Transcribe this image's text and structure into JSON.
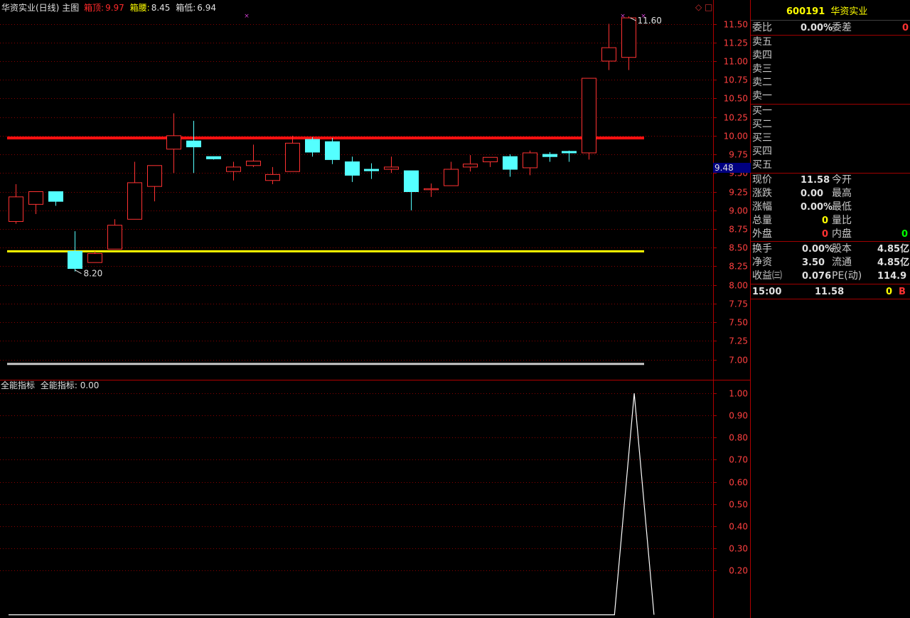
{
  "header": {
    "stock_title": "华资实业(日线)",
    "main_chart_label": "主图",
    "box_top_label": "箱顶:",
    "box_top_value": "9.97",
    "box_waist_label": "箱腰:",
    "box_waist_value": "8.45",
    "box_low_label": "箱低:",
    "box_low_value": "6.94"
  },
  "indicator": {
    "title": "全能指标",
    "name": "全能指标:",
    "value": "0.00"
  },
  "price_axis": {
    "ticks": [
      "11.50",
      "11.25",
      "11.00",
      "10.75",
      "10.50",
      "10.25",
      "10.00",
      "9.75",
      "9.50",
      "9.25",
      "9.00",
      "8.75",
      "8.50",
      "8.25",
      "8.00",
      "7.75",
      "7.50",
      "7.25",
      "7.00"
    ],
    "current_marker": "9.48"
  },
  "indicator_axis": {
    "ticks": [
      "1.00",
      "0.90",
      "0.80",
      "0.70",
      "0.60",
      "0.50",
      "0.40",
      "0.30",
      "0.20"
    ]
  },
  "annotations": {
    "high_label": "11.60",
    "low_label": "8.20"
  },
  "colors": {
    "up": "#ff3232",
    "down": "#54ffff",
    "box_top_line": "#ff1010",
    "box_waist_line": "#ffff00",
    "box_low_line": "#c8c8c8",
    "grid": "#8b0000",
    "indicator_line": "#ffffff"
  },
  "chart_data": {
    "type": "candlestick",
    "y_range": [
      6.85,
      11.7
    ],
    "candles": [
      {
        "o": 8.85,
        "h": 9.35,
        "l": 8.82,
        "c": 9.18
      },
      {
        "o": 9.08,
        "h": 9.25,
        "l": 8.95,
        "c": 9.25
      },
      {
        "o": 9.25,
        "h": 9.25,
        "l": 9.06,
        "c": 9.12
      },
      {
        "o": 8.45,
        "h": 8.72,
        "l": 8.18,
        "c": 8.22
      },
      {
        "o": 8.3,
        "h": 8.45,
        "l": 8.3,
        "c": 8.42
      },
      {
        "o": 8.48,
        "h": 8.88,
        "l": 8.48,
        "c": 8.8
      },
      {
        "o": 8.88,
        "h": 9.65,
        "l": 8.88,
        "c": 9.37
      },
      {
        "o": 9.32,
        "h": 9.6,
        "l": 9.12,
        "c": 9.6
      },
      {
        "o": 9.82,
        "h": 10.3,
        "l": 9.5,
        "c": 10.0
      },
      {
        "o": 9.93,
        "h": 10.2,
        "l": 9.5,
        "c": 9.85
      },
      {
        "o": 9.72,
        "h": 9.72,
        "l": 9.68,
        "c": 9.69
      },
      {
        "o": 9.52,
        "h": 9.65,
        "l": 9.4,
        "c": 9.58
      },
      {
        "o": 9.6,
        "h": 9.88,
        "l": 9.58,
        "c": 9.66
      },
      {
        "o": 9.4,
        "h": 9.58,
        "l": 9.35,
        "c": 9.48
      },
      {
        "o": 9.52,
        "h": 10.0,
        "l": 9.52,
        "c": 9.9
      },
      {
        "o": 9.95,
        "h": 9.98,
        "l": 9.72,
        "c": 9.78
      },
      {
        "o": 9.92,
        "h": 9.97,
        "l": 9.62,
        "c": 9.68
      },
      {
        "o": 9.65,
        "h": 9.72,
        "l": 9.38,
        "c": 9.47
      },
      {
        "o": 9.55,
        "h": 9.63,
        "l": 9.42,
        "c": 9.53
      },
      {
        "o": 9.55,
        "h": 9.72,
        "l": 9.5,
        "c": 9.58
      },
      {
        "o": 9.53,
        "h": 9.53,
        "l": 9.0,
        "c": 9.25
      },
      {
        "o": 9.29,
        "h": 9.36,
        "l": 9.18,
        "c": 9.29
      },
      {
        "o": 9.33,
        "h": 9.65,
        "l": 9.33,
        "c": 9.55
      },
      {
        "o": 9.58,
        "h": 9.74,
        "l": 9.52,
        "c": 9.62
      },
      {
        "o": 9.65,
        "h": 9.7,
        "l": 9.58,
        "c": 9.71
      },
      {
        "o": 9.72,
        "h": 9.75,
        "l": 9.45,
        "c": 9.55
      },
      {
        "o": 9.57,
        "h": 9.8,
        "l": 9.47,
        "c": 9.77
      },
      {
        "o": 9.75,
        "h": 9.78,
        "l": 9.65,
        "c": 9.72
      },
      {
        "o": 9.79,
        "h": 9.8,
        "l": 9.65,
        "c": 9.77
      },
      {
        "o": 9.77,
        "h": 10.77,
        "l": 9.68,
        "c": 10.77
      },
      {
        "o": 11.0,
        "h": 11.5,
        "l": 10.88,
        "c": 11.18
      },
      {
        "o": 11.05,
        "h": 11.6,
        "l": 10.88,
        "c": 11.58
      }
    ],
    "box_top": 9.97,
    "box_waist": 8.45,
    "box_low": 6.94,
    "indicator": {
      "y_range": [
        0,
        1.0
      ],
      "points": [
        [
          0,
          0
        ],
        [
          30.3,
          0
        ],
        [
          31.3,
          1.0
        ],
        [
          32.3,
          0
        ]
      ]
    }
  },
  "quote_panel": {
    "code": "600191",
    "name": "华资实业",
    "weibi_label": "委比",
    "weibi_value": "0.00%",
    "weicha_label": "委差",
    "weicha_value": "0",
    "sell_labels": [
      "卖五",
      "卖四",
      "卖三",
      "卖二",
      "卖一"
    ],
    "buy_labels": [
      "买一",
      "买二",
      "买三",
      "买四",
      "买五"
    ],
    "stats": [
      {
        "l1": "现价",
        "v1": "11.58",
        "l2": "今开",
        "v2": ""
      },
      {
        "l1": "涨跌",
        "v1": "0.00",
        "l2": "最高",
        "v2": ""
      },
      {
        "l1": "涨幅",
        "v1": "0.00%",
        "l2": "最低",
        "v2": ""
      },
      {
        "l1": "总量",
        "v1": "0",
        "l2": "量比",
        "v2": ""
      },
      {
        "l1": "外盘",
        "v1": "0",
        "l2": "内盘",
        "v2": "0"
      }
    ],
    "stats2": [
      {
        "l1": "换手",
        "v1": "0.00%",
        "l2": "股本",
        "v2": "4.85亿"
      },
      {
        "l1": "净资",
        "v1": "3.50",
        "l2": "流通",
        "v2": "4.85亿"
      },
      {
        "l1": "收益㈢",
        "v1": "0.076",
        "l2": "PE(动)",
        "v2": "114.9"
      }
    ],
    "tick": {
      "time": "15:00",
      "price": "11.58",
      "vol": "0",
      "flag": "B"
    }
  }
}
